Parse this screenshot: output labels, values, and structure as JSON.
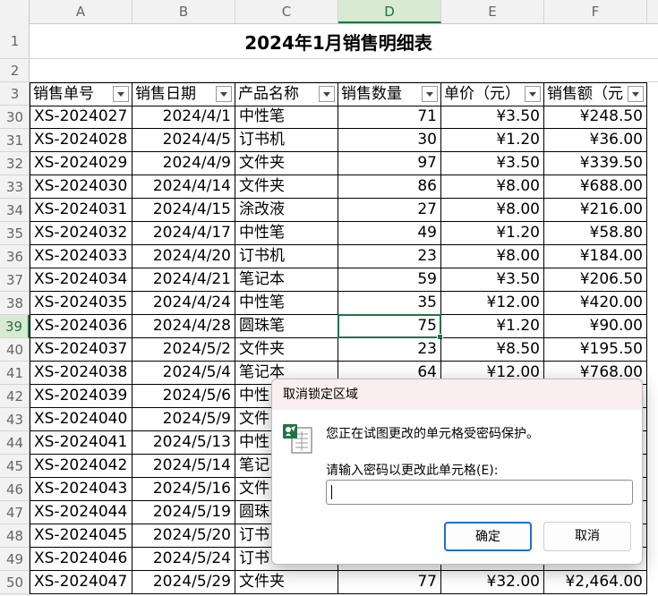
{
  "columns": [
    "A",
    "B",
    "C",
    "D",
    "E",
    "F"
  ],
  "selected_column": "D",
  "top_rows": [
    "1",
    "2",
    "3"
  ],
  "sheet_title": "2024年1月销售明细表",
  "headers": [
    "销售单号",
    "销售日期",
    "产品名称",
    "销售数量",
    "单价（元）",
    "销售额（元"
  ],
  "rows": [
    {
      "num": "30",
      "id": "XS-2024027",
      "date": "2024/4/1",
      "product": "中性笔",
      "qty": "71",
      "price": "¥3.50",
      "amount": "¥248.50"
    },
    {
      "num": "31",
      "id": "XS-2024028",
      "date": "2024/4/5",
      "product": "订书机",
      "qty": "30",
      "price": "¥1.20",
      "amount": "¥36.00"
    },
    {
      "num": "32",
      "id": "XS-2024029",
      "date": "2024/4/9",
      "product": "文件夹",
      "qty": "97",
      "price": "¥3.50",
      "amount": "¥339.50"
    },
    {
      "num": "33",
      "id": "XS-2024030",
      "date": "2024/4/14",
      "product": "文件夹",
      "qty": "86",
      "price": "¥8.00",
      "amount": "¥688.00"
    },
    {
      "num": "34",
      "id": "XS-2024031",
      "date": "2024/4/15",
      "product": "涂改液",
      "qty": "27",
      "price": "¥8.00",
      "amount": "¥216.00"
    },
    {
      "num": "35",
      "id": "XS-2024032",
      "date": "2024/4/17",
      "product": "中性笔",
      "qty": "49",
      "price": "¥1.20",
      "amount": "¥58.80"
    },
    {
      "num": "36",
      "id": "XS-2024033",
      "date": "2024/4/20",
      "product": "订书机",
      "qty": "23",
      "price": "¥8.00",
      "amount": "¥184.00"
    },
    {
      "num": "37",
      "id": "XS-2024034",
      "date": "2024/4/21",
      "product": "笔记本",
      "qty": "59",
      "price": "¥3.50",
      "amount": "¥206.50"
    },
    {
      "num": "38",
      "id": "XS-2024035",
      "date": "2024/4/24",
      "product": "中性笔",
      "qty": "35",
      "price": "¥12.00",
      "amount": "¥420.00"
    },
    {
      "num": "39",
      "id": "XS-2024036",
      "date": "2024/4/28",
      "product": "圆珠笔",
      "qty": "75",
      "price": "¥1.20",
      "amount": "¥90.00"
    },
    {
      "num": "40",
      "id": "XS-2024037",
      "date": "2024/5/2",
      "product": "文件夹",
      "qty": "23",
      "price": "¥8.50",
      "amount": "¥195.50"
    },
    {
      "num": "41",
      "id": "XS-2024038",
      "date": "2024/5/4",
      "product": "笔记本",
      "qty": "64",
      "price": "¥12.00",
      "amount": "¥768.00"
    },
    {
      "num": "42",
      "id": "XS-2024039",
      "date": "2024/5/6",
      "product": "中性",
      "qty": "",
      "price": "",
      "amount": ""
    },
    {
      "num": "43",
      "id": "XS-2024040",
      "date": "2024/5/9",
      "product": "文件",
      "qty": "",
      "price": "",
      "amount": ""
    },
    {
      "num": "44",
      "id": "XS-2024041",
      "date": "2024/5/13",
      "product": "中性",
      "qty": "",
      "price": "",
      "amount": ""
    },
    {
      "num": "45",
      "id": "XS-2024042",
      "date": "2024/5/14",
      "product": "笔记",
      "qty": "",
      "price": "",
      "amount": ""
    },
    {
      "num": "46",
      "id": "XS-2024043",
      "date": "2024/5/16",
      "product": "文件",
      "qty": "",
      "price": "",
      "amount": ""
    },
    {
      "num": "47",
      "id": "XS-2024044",
      "date": "2024/5/19",
      "product": "圆珠",
      "qty": "",
      "price": "",
      "amount": ""
    },
    {
      "num": "48",
      "id": "XS-2024045",
      "date": "2024/5/20",
      "product": "订书",
      "qty": "",
      "price": "",
      "amount": ""
    },
    {
      "num": "49",
      "id": "XS-2024046",
      "date": "2024/5/24",
      "product": "订书",
      "qty": "",
      "price": "",
      "amount": ""
    },
    {
      "num": "50",
      "id": "XS-2024047",
      "date": "2024/5/29",
      "product": "文件夹",
      "qty": "77",
      "price": "¥32.00",
      "amount": "¥2,464.00"
    }
  ],
  "selected_row": "39",
  "dialog": {
    "title": "取消锁定区域",
    "message": "您正在试图更改的单元格受密码保护。",
    "prompt": "请输入密码以更改此单元格(E):",
    "password_value": "",
    "ok_label": "确定",
    "cancel_label": "取消",
    "icon": "protected-sheet-icon"
  },
  "colors": {
    "accent": "#217346",
    "dialog_title_bg": "#fbeef0",
    "ok_border": "#1f6fd0"
  }
}
